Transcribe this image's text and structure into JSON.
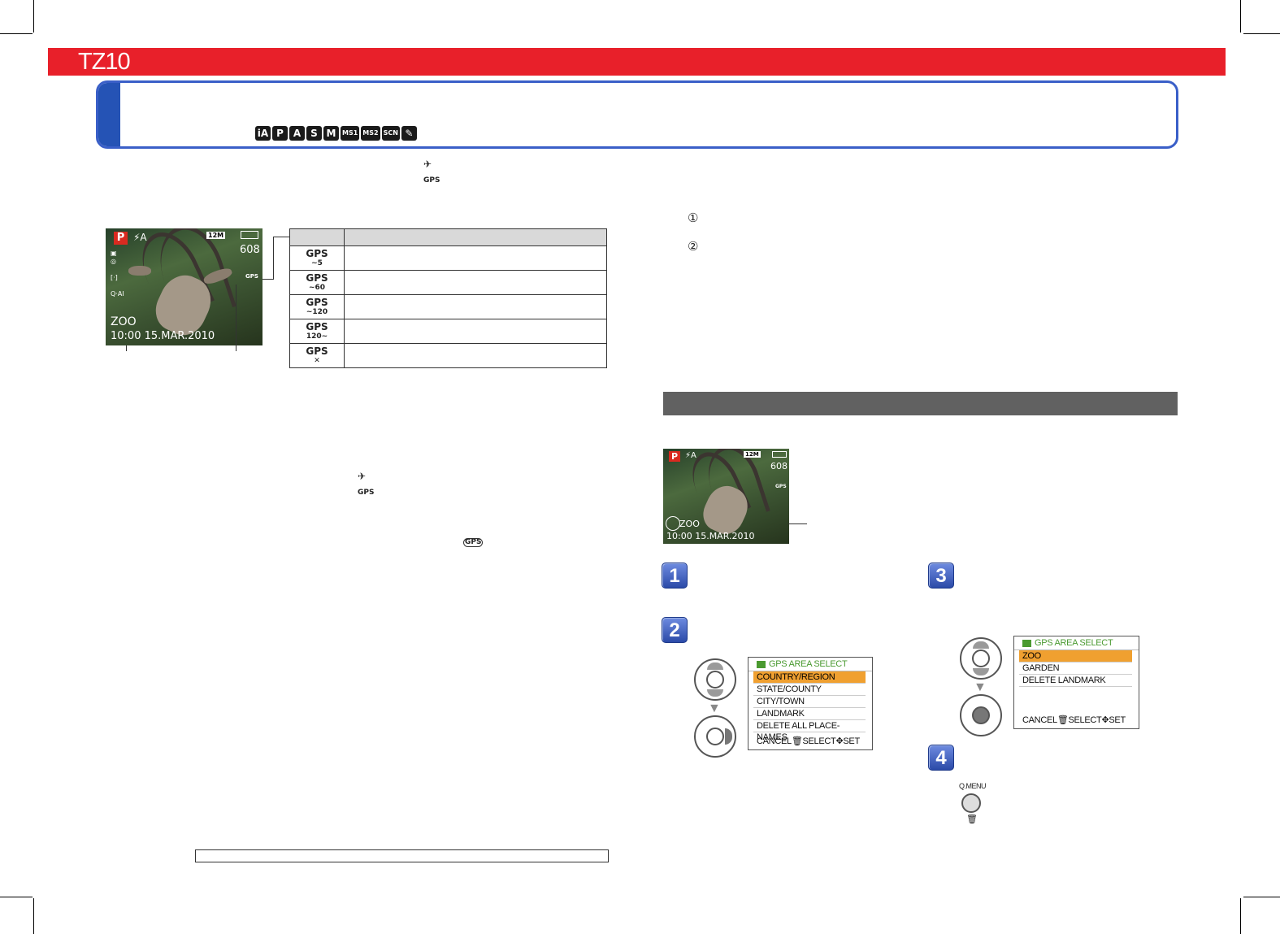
{
  "header": {
    "model": "TZ10",
    "modes": [
      "iA",
      "P",
      "A",
      "S",
      "M",
      "MS1",
      "MS2",
      "SCN",
      "✎"
    ]
  },
  "gps_icon_inline": "GPS",
  "screen_left": {
    "mode_badge": "P",
    "flash": "⚡A",
    "picture_size": "12M",
    "shots_remaining": "608",
    "place_name": "ZOO",
    "datetime": "10:00  15.MAR.2010",
    "gps_small": "GPS"
  },
  "gps_table": {
    "rows": [
      {
        "icon": "GPS",
        "sub": "~5"
      },
      {
        "icon": "GPS",
        "sub": "~60"
      },
      {
        "icon": "GPS",
        "sub": "~120"
      },
      {
        "icon": "GPS",
        "sub": "120~"
      },
      {
        "icon": "GPS",
        "sub": "✕"
      }
    ]
  },
  "circled_numbers": [
    "①",
    "②"
  ],
  "screen_right": {
    "mode_badge": "P",
    "flash": "⚡A",
    "picture_size": "12M",
    "shots_remaining": "608",
    "place_name": "ZOO",
    "datetime": "10:00  15.MAR.2010",
    "gps_small": "GPS"
  },
  "steps": [
    "1",
    "2",
    "3",
    "4"
  ],
  "menu_region": {
    "title": "GPS AREA SELECT",
    "items": [
      "COUNTRY/REGION",
      "STATE/COUNTY",
      "CITY/TOWN",
      "LANDMARK",
      "DELETE ALL PLACE-NAMES"
    ],
    "footer": "CANCEL🗑SELECT✥SET"
  },
  "menu_landmark": {
    "title": "GPS AREA SELECT",
    "items": [
      "ZOO",
      "GARDEN",
      "DELETE LANDMARK"
    ],
    "footer": "CANCEL🗑SELECT✥SET"
  },
  "qmenu_label": "Q.MENU",
  "qmenu_sub": "🗑",
  "colors": {
    "banner": "#e8202a",
    "title_border": "#3a5fc8",
    "step_blue": "#2b4aa8",
    "menu_highlight": "#f0a030"
  }
}
